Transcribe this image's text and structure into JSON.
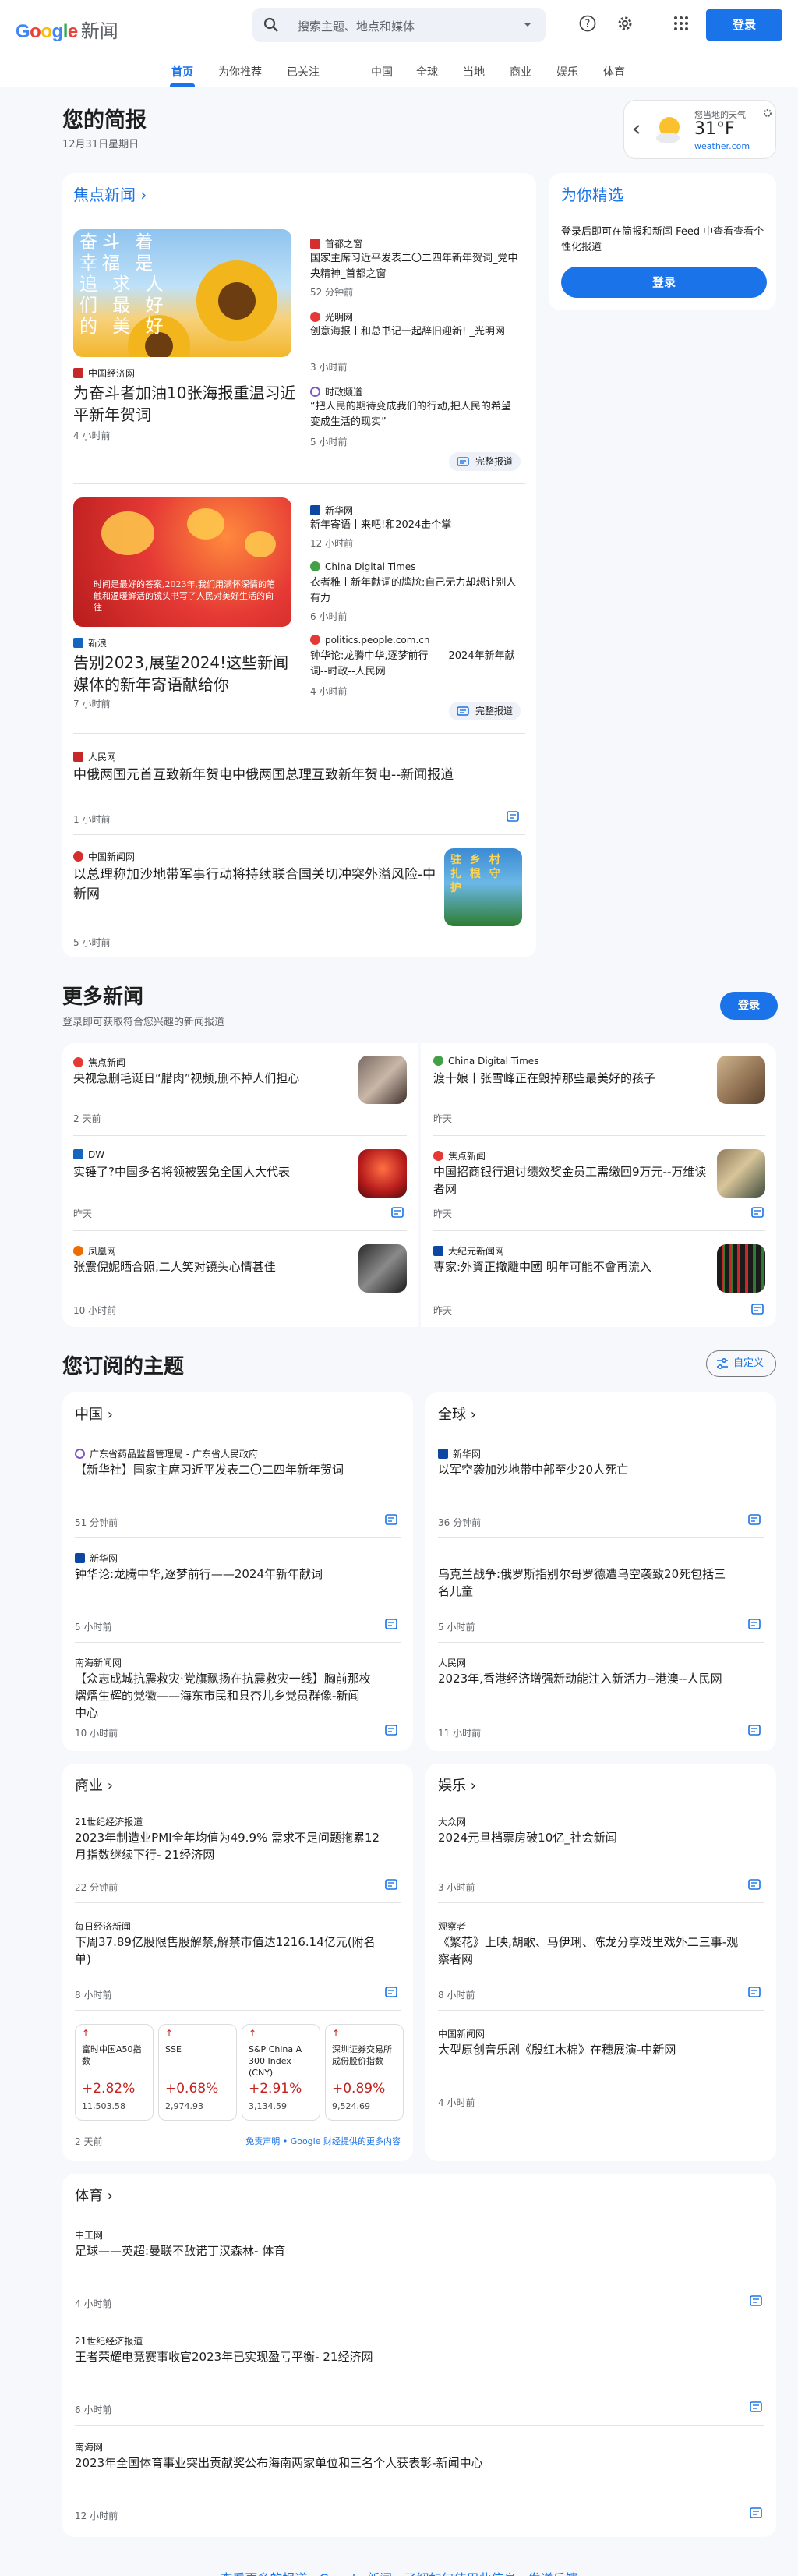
{
  "header": {
    "logo_google": "Google",
    "logo_news": "新闻",
    "search_placeholder": "搜索主题、地点和媒体",
    "signin": "登录"
  },
  "nav": [
    "首页",
    "为你推荐",
    "已关注",
    "中国",
    "全球",
    "当地",
    "商业",
    "娱乐",
    "体育"
  ],
  "briefing": {
    "title": "您的简报",
    "date": "12月31日星期日"
  },
  "weather": {
    "label": "您当地的天气",
    "temp": "31°F",
    "source": "weather.com"
  },
  "headlines": {
    "title": "焦点新闻",
    "full_coverage": "完整报道",
    "clusters": [
      {
        "main": {
          "source": "中国经济网",
          "title": "为奋斗者加油10张海报重温习近平新年贺词",
          "time": "4 小时前",
          "image_text": "奋斗 着 幸福 是 追 求 人 们 最 好 的 美 好"
        },
        "side": [
          {
            "source": "首都之窗",
            "title": "国家主席习近平发表二〇二四年新年贺词_党中央精神_首都之窗",
            "time": "52 分钟前"
          },
          {
            "source": "光明网",
            "title": "创意海报丨和总书记一起辞旧迎新! _光明网",
            "time": "3 小时前"
          },
          {
            "source": "时政频道",
            "title": "“把人民的期待变成我们的行动,把人民的希望变成生活的现实”",
            "time": "5 小时前"
          }
        ]
      },
      {
        "main": {
          "source": "新浪",
          "title": "告别2023,展望2024!这些新闻媒体的新年寄语献给你",
          "time": "7 小时前",
          "image_text": "时间是最好的答案,2023年,我们用满怀深情的笔触和温暖鲜活的镜头书写了人民对美好生活的向往"
        },
        "side": [
          {
            "source": "新华网",
            "title": "新年寄语丨来吧!和2024击个掌",
            "time": "12 小时前"
          },
          {
            "source": "China Digital Times",
            "title": "衣者稚丨新年献词的尴尬:自己无力却想让别人有力",
            "time": "6 小时前"
          },
          {
            "source": "politics.people.com.cn",
            "title": "钟华论:龙腾中华,逐梦前行——2024年新年献词--时政--人民网",
            "time": "4 小时前"
          }
        ]
      }
    ],
    "singles": [
      {
        "source": "人民网",
        "title": "中俄两国元首互致新年贺电中俄两国总理互致新年贺电--新闻报道",
        "time": "1 小时前"
      },
      {
        "source": "中国新闻网",
        "title": "以总理称加沙地带军事行动将持续联合国关切冲突外溢风险-中新网",
        "time": "5 小时前",
        "image_text": "驻 乡 村 扎 根 守 护"
      }
    ]
  },
  "picks": {
    "title": "为你精选",
    "desc": "登录后即可在简报和新闻 Feed 中查看查看个性化报道",
    "btn": "登录"
  },
  "more_news": {
    "title": "更多新闻",
    "sub": "登录即可获取符合您兴趣的新闻报道",
    "btn": "登录",
    "items": [
      {
        "source": "焦点新闻",
        "title": "央视急删毛诞日“腊肉”视频,删不掉人们担心",
        "time": "2 天前"
      },
      {
        "source": "China Digital Times",
        "title": "渡十娘丨张雪峰正在毁掉那些最美好的孩子",
        "time": "昨天"
      },
      {
        "source": "DW",
        "title": "实锤了?中国多名将领被罢免全国人大代表",
        "time": "昨天"
      },
      {
        "source": "焦点新闻",
        "title": "中国招商银行退讨绩效奖金员工需缴回9万元--万维读者网",
        "time": "昨天"
      },
      {
        "source": "凤凰网",
        "title": "张震倪妮晒合照,二人笑对镜头心情甚佳",
        "time": "10 小时前"
      },
      {
        "source": "大纪元新闻网",
        "title": "專家:外資正撤離中國 明年可能不會再流入",
        "time": "昨天"
      }
    ]
  },
  "topics": {
    "title": "您订阅的主题",
    "customize": "自定义",
    "china": {
      "label": "中国",
      "items": [
        {
          "source": "广东省药品监督管理局 - 广东省人民政府",
          "title": "【新华社】国家主席习近平发表二〇二四年新年贺词",
          "time": "51 分钟前"
        },
        {
          "source": "新华网",
          "title": "钟华论:龙腾中华,逐梦前行——2024年新年献词",
          "time": "5 小时前"
        },
        {
          "source": "南海新闻网",
          "title": "【众志成城抗震救灾·党旗飘扬在抗震救灾一线】胸前那枚熠熠生辉的党徽——海东市民和县杏儿乡党员群像-新闻中心",
          "time": "10 小时前"
        }
      ]
    },
    "world": {
      "label": "全球",
      "items": [
        {
          "source": "新华网",
          "title": "以军空袭加沙地带中部至少20人死亡",
          "time": "36 分钟前"
        },
        {
          "source": "",
          "title": "乌克兰战争:俄罗斯指别尔哥罗德遭乌空袭致20死包括三名儿童",
          "time": "5 小时前"
        },
        {
          "source": "人民网",
          "title": "2023年,香港经济增强新动能注入新活力--港澳--人民网",
          "time": "11 小时前"
        }
      ]
    },
    "business": {
      "label": "商业",
      "items": [
        {
          "source": "21世纪经济报道",
          "title": "2023年制造业PMI全年均值为49.9% 需求不足问题拖累12月指数继续下行- 21经济网",
          "time": "22 分钟前"
        },
        {
          "source": "每日经济新闻",
          "title": "下周37.89亿股限售股解禁,解禁市值达1216.14亿元(附名单)",
          "time": "8 小时前"
        }
      ],
      "stocks": [
        {
          "name": "富时中国A50指数",
          "change": "+2.82%",
          "price": "11,503.58"
        },
        {
          "name": "SSE",
          "change": "+0.68%",
          "price": "2,974.93"
        },
        {
          "name": "S&P China A 300 Index (CNY)",
          "change": "+2.91%",
          "price": "3,134.59"
        },
        {
          "name": "深圳证券交易所成份股价指数",
          "change": "+0.89%",
          "price": "9,524.69"
        }
      ],
      "stocks_time": "2 天前",
      "disclaimer": "免责声明 • Google 财经提供的更多内容"
    },
    "entertainment": {
      "label": "娱乐",
      "items": [
        {
          "source": "大众网",
          "title": "2024元旦档票房破10亿_社会新闻",
          "time": "3 小时前"
        },
        {
          "source": "观察者",
          "title": "《繁花》上映,胡歌、马伊琍、陈龙分享戏里戏外二三事-观察者网",
          "time": "8 小时前"
        },
        {
          "source": "中国新闻网",
          "title": "大型原创音乐剧《殷红木棉》在穗展演-中新网",
          "time": "4 小时前"
        }
      ]
    },
    "sports": {
      "label": "体育",
      "items": [
        {
          "source": "中工网",
          "title": "足球——英超:曼联不敌诺丁汉森林- 体育",
          "time": "4 小时前"
        },
        {
          "source": "21世纪经济报道",
          "title": "王者荣耀电竞赛事收官2023年已实现盈亏平衡- 21经济网",
          "time": "6 小时前"
        },
        {
          "source": "南海网",
          "title": "2023年全国体育事业突出贡献奖公布海南两家单位和三名个人获表彰-新闻中心",
          "time": "12 小时前"
        }
      ]
    }
  },
  "colors": {
    "accent": "#1a73e8",
    "down_red": "#c5221f"
  },
  "footer": "查看更多的报道 · Google 新闻 · 了解如何使用此信息 · 发送反馈"
}
